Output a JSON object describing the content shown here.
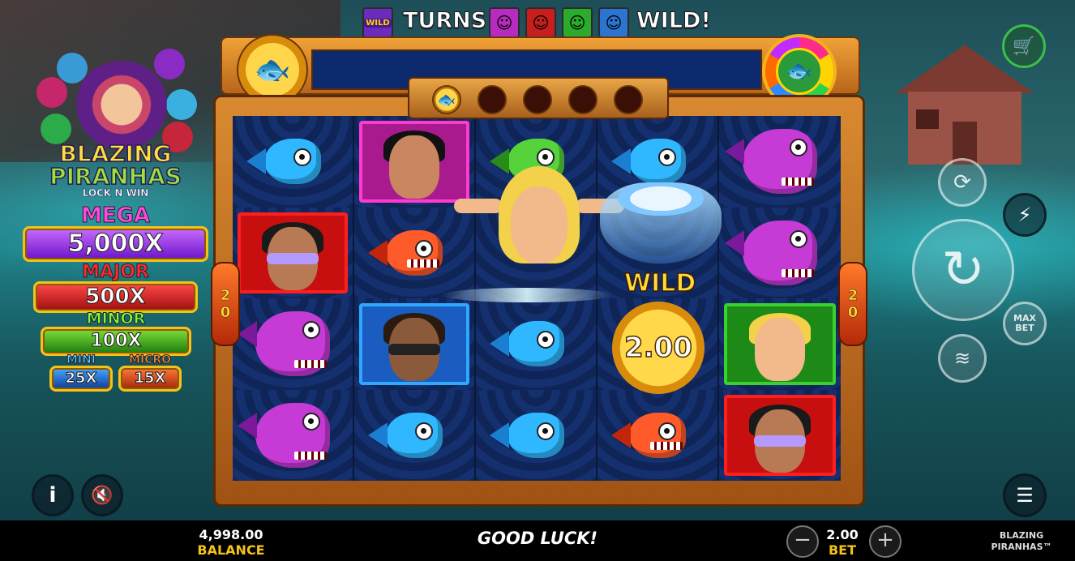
{
  "banner": {
    "wild_icon_text": "WILD",
    "word_turns": "TURNS",
    "word_wild": "WILD!"
  },
  "logo": {
    "line1": "BLAZING",
    "line2": "PIRANHAS",
    "tm": "TM",
    "line3": "LOCK N WIN"
  },
  "jackpots": {
    "mega": {
      "label": "MEGA",
      "value": "5,000X"
    },
    "major": {
      "label": "MAJOR",
      "value": "500X"
    },
    "minor": {
      "label": "MINOR",
      "value": "100X"
    },
    "mini": {
      "label": "MINI",
      "value": "25X"
    },
    "micro": {
      "label": "MICRO",
      "value": "15X"
    }
  },
  "reels": {
    "lines_left": "20",
    "lines_right": "20",
    "wild_label": "WILD",
    "coin_value": "2.00",
    "collect_slots": 5,
    "collect_filled": 1,
    "grid": [
      [
        "fish-blue",
        "portrait-pink",
        "fish-green",
        "fish-blue",
        "fish-purple"
      ],
      [
        "portrait-red",
        "fish-red",
        "wild-expand",
        "wild-coin",
        "fish-purple"
      ],
      [
        "fish-purple",
        "portrait-blue",
        "fish-blue",
        "wild-coin",
        "portrait-green"
      ],
      [
        "fish-purple",
        "fish-blue",
        "fish-blue",
        "fish-red",
        "portrait-red"
      ]
    ]
  },
  "controls": {
    "cart_icon": "cart-icon",
    "autoplay_icon": "autoplay-icon",
    "turbo_icon": "lightning-icon",
    "spin_icon": "spin-icon",
    "max_bet_label": "MAX BET",
    "coins_icon": "coins-icon",
    "info_icon": "info-icon",
    "sound_icon": "sound-muted-icon",
    "menu_icon": "menu-icon"
  },
  "footer": {
    "balance_value": "4,998.00",
    "balance_label": "BALANCE",
    "message": "GOOD LUCK!",
    "bet_value": "2.00",
    "bet_label": "BET",
    "brand_line1": "BLAZING",
    "brand_line2": "PIRANHAS™"
  },
  "colors": {
    "accent_gold": "#f5c21a",
    "reel_bg": "#0d1e4a",
    "frame_orange": "#d98a30"
  }
}
